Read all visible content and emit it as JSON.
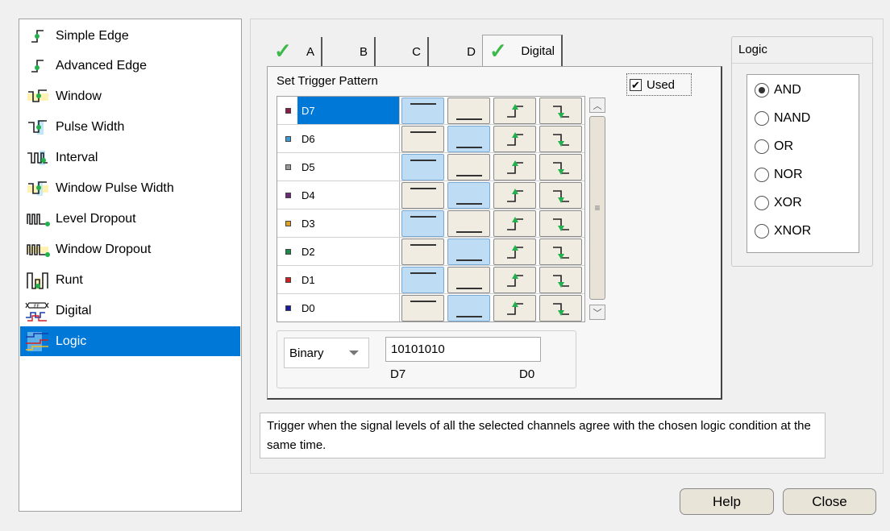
{
  "trigger_list": {
    "items": [
      {
        "label": "Simple Edge",
        "icon": "simple-edge-icon"
      },
      {
        "label": "Advanced Edge",
        "icon": "advanced-edge-icon"
      },
      {
        "label": "Window",
        "icon": "window-icon"
      },
      {
        "label": "Pulse Width",
        "icon": "pulse-width-icon"
      },
      {
        "label": "Interval",
        "icon": "interval-icon"
      },
      {
        "label": "Window Pulse Width",
        "icon": "window-pulse-width-icon"
      },
      {
        "label": "Level Dropout",
        "icon": "level-dropout-icon"
      },
      {
        "label": "Window Dropout",
        "icon": "window-dropout-icon"
      },
      {
        "label": "Runt",
        "icon": "runt-icon"
      },
      {
        "label": "Digital",
        "icon": "digital-icon"
      },
      {
        "label": "Logic",
        "icon": "logic-icon"
      }
    ],
    "selected": "Logic"
  },
  "tabs": [
    {
      "label": "A",
      "checked": true
    },
    {
      "label": "B",
      "checked": false
    },
    {
      "label": "C",
      "checked": false
    },
    {
      "label": "D",
      "checked": false
    },
    {
      "label": "Digital",
      "checked": true,
      "active": true
    }
  ],
  "pattern": {
    "title": "Set Trigger Pattern",
    "used_label": "Used",
    "used_checked": true,
    "rows": [
      {
        "name": "D7",
        "color": "#8b1a4a",
        "state": "high",
        "selected": true
      },
      {
        "name": "D6",
        "color": "#3a9bd5",
        "state": "low"
      },
      {
        "name": "D5",
        "color": "#9a9a9a",
        "state": "high"
      },
      {
        "name": "D4",
        "color": "#6a2a7a",
        "state": "low"
      },
      {
        "name": "D3",
        "color": "#e0a020",
        "state": "high"
      },
      {
        "name": "D2",
        "color": "#1a8a4a",
        "state": "low"
      },
      {
        "name": "D1",
        "color": "#d02020",
        "state": "high"
      },
      {
        "name": "D0",
        "color": "#1a1aa0",
        "state": "low"
      }
    ],
    "format": "Binary",
    "value": "10101010",
    "msb_label": "D7",
    "lsb_label": "D0"
  },
  "description": "Trigger when the signal levels of all the selected channels agree with the chosen logic condition at the same time.",
  "logic": {
    "title": "Logic",
    "options": [
      "AND",
      "NAND",
      "OR",
      "NOR",
      "XOR",
      "XNOR"
    ],
    "selected": "AND"
  },
  "buttons": {
    "help": "Help",
    "close": "Close"
  },
  "colors": {
    "selection": "#0078d7",
    "pressed": "#bfdcf5",
    "button_face": "#f1ece1",
    "check_green": "#3db84a"
  }
}
